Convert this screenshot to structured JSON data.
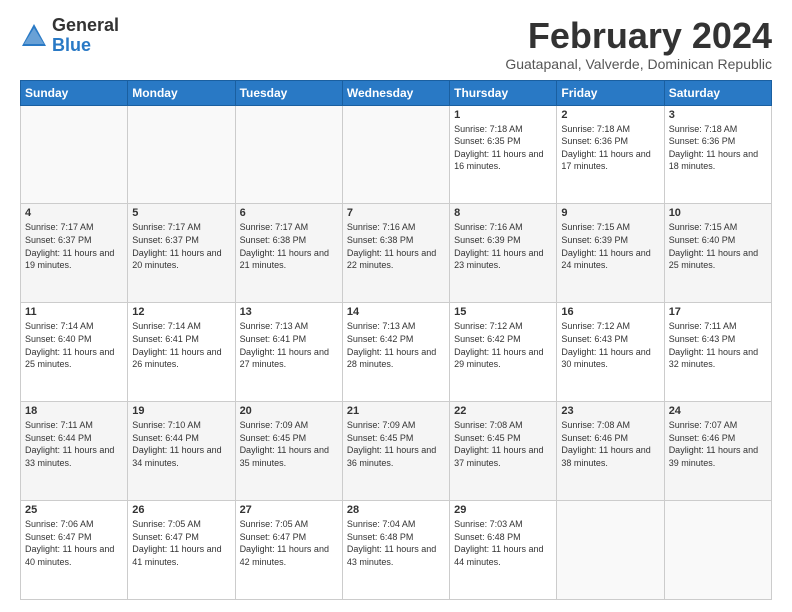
{
  "logo": {
    "general": "General",
    "blue": "Blue"
  },
  "title": "February 2024",
  "subtitle": "Guatapanal, Valverde, Dominican Republic",
  "days_of_week": [
    "Sunday",
    "Monday",
    "Tuesday",
    "Wednesday",
    "Thursday",
    "Friday",
    "Saturday"
  ],
  "weeks": [
    [
      {
        "day": "",
        "info": ""
      },
      {
        "day": "",
        "info": ""
      },
      {
        "day": "",
        "info": ""
      },
      {
        "day": "",
        "info": ""
      },
      {
        "day": "1",
        "info": "Sunrise: 7:18 AM\nSunset: 6:35 PM\nDaylight: 11 hours and 16 minutes."
      },
      {
        "day": "2",
        "info": "Sunrise: 7:18 AM\nSunset: 6:36 PM\nDaylight: 11 hours and 17 minutes."
      },
      {
        "day": "3",
        "info": "Sunrise: 7:18 AM\nSunset: 6:36 PM\nDaylight: 11 hours and 18 minutes."
      }
    ],
    [
      {
        "day": "4",
        "info": "Sunrise: 7:17 AM\nSunset: 6:37 PM\nDaylight: 11 hours and 19 minutes."
      },
      {
        "day": "5",
        "info": "Sunrise: 7:17 AM\nSunset: 6:37 PM\nDaylight: 11 hours and 20 minutes."
      },
      {
        "day": "6",
        "info": "Sunrise: 7:17 AM\nSunset: 6:38 PM\nDaylight: 11 hours and 21 minutes."
      },
      {
        "day": "7",
        "info": "Sunrise: 7:16 AM\nSunset: 6:38 PM\nDaylight: 11 hours and 22 minutes."
      },
      {
        "day": "8",
        "info": "Sunrise: 7:16 AM\nSunset: 6:39 PM\nDaylight: 11 hours and 23 minutes."
      },
      {
        "day": "9",
        "info": "Sunrise: 7:15 AM\nSunset: 6:39 PM\nDaylight: 11 hours and 24 minutes."
      },
      {
        "day": "10",
        "info": "Sunrise: 7:15 AM\nSunset: 6:40 PM\nDaylight: 11 hours and 25 minutes."
      }
    ],
    [
      {
        "day": "11",
        "info": "Sunrise: 7:14 AM\nSunset: 6:40 PM\nDaylight: 11 hours and 25 minutes."
      },
      {
        "day": "12",
        "info": "Sunrise: 7:14 AM\nSunset: 6:41 PM\nDaylight: 11 hours and 26 minutes."
      },
      {
        "day": "13",
        "info": "Sunrise: 7:13 AM\nSunset: 6:41 PM\nDaylight: 11 hours and 27 minutes."
      },
      {
        "day": "14",
        "info": "Sunrise: 7:13 AM\nSunset: 6:42 PM\nDaylight: 11 hours and 28 minutes."
      },
      {
        "day": "15",
        "info": "Sunrise: 7:12 AM\nSunset: 6:42 PM\nDaylight: 11 hours and 29 minutes."
      },
      {
        "day": "16",
        "info": "Sunrise: 7:12 AM\nSunset: 6:43 PM\nDaylight: 11 hours and 30 minutes."
      },
      {
        "day": "17",
        "info": "Sunrise: 7:11 AM\nSunset: 6:43 PM\nDaylight: 11 hours and 32 minutes."
      }
    ],
    [
      {
        "day": "18",
        "info": "Sunrise: 7:11 AM\nSunset: 6:44 PM\nDaylight: 11 hours and 33 minutes."
      },
      {
        "day": "19",
        "info": "Sunrise: 7:10 AM\nSunset: 6:44 PM\nDaylight: 11 hours and 34 minutes."
      },
      {
        "day": "20",
        "info": "Sunrise: 7:09 AM\nSunset: 6:45 PM\nDaylight: 11 hours and 35 minutes."
      },
      {
        "day": "21",
        "info": "Sunrise: 7:09 AM\nSunset: 6:45 PM\nDaylight: 11 hours and 36 minutes."
      },
      {
        "day": "22",
        "info": "Sunrise: 7:08 AM\nSunset: 6:45 PM\nDaylight: 11 hours and 37 minutes."
      },
      {
        "day": "23",
        "info": "Sunrise: 7:08 AM\nSunset: 6:46 PM\nDaylight: 11 hours and 38 minutes."
      },
      {
        "day": "24",
        "info": "Sunrise: 7:07 AM\nSunset: 6:46 PM\nDaylight: 11 hours and 39 minutes."
      }
    ],
    [
      {
        "day": "25",
        "info": "Sunrise: 7:06 AM\nSunset: 6:47 PM\nDaylight: 11 hours and 40 minutes."
      },
      {
        "day": "26",
        "info": "Sunrise: 7:05 AM\nSunset: 6:47 PM\nDaylight: 11 hours and 41 minutes."
      },
      {
        "day": "27",
        "info": "Sunrise: 7:05 AM\nSunset: 6:47 PM\nDaylight: 11 hours and 42 minutes."
      },
      {
        "day": "28",
        "info": "Sunrise: 7:04 AM\nSunset: 6:48 PM\nDaylight: 11 hours and 43 minutes."
      },
      {
        "day": "29",
        "info": "Sunrise: 7:03 AM\nSunset: 6:48 PM\nDaylight: 11 hours and 44 minutes."
      },
      {
        "day": "",
        "info": ""
      },
      {
        "day": "",
        "info": ""
      }
    ]
  ]
}
